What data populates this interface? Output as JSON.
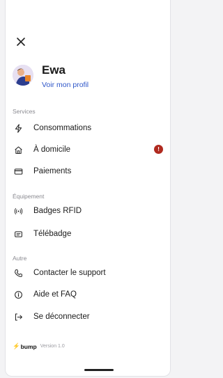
{
  "profile": {
    "name": "Ewa",
    "link": "Voir mon profil"
  },
  "sections": {
    "services": "Services",
    "equipment": "Équipement",
    "other": "Autre"
  },
  "menu": {
    "consommations": {
      "label": "Consommations",
      "icon": "lightning-icon"
    },
    "a_domicile": {
      "label": "À domicile",
      "icon": "home-icon",
      "badge": "!"
    },
    "paiements": {
      "label": "Paiements",
      "icon": "credit-card-icon"
    },
    "badges_rfid": {
      "label": "Badges RFID",
      "icon": "rfid-icon"
    },
    "telebadge": {
      "label": "Télébadge",
      "icon": "telebadge-icon"
    },
    "support": {
      "label": "Contacter le support",
      "icon": "phone-icon"
    },
    "faq": {
      "label": "Aide et FAQ",
      "icon": "info-icon"
    },
    "logout": {
      "label": "Se déconnecter",
      "icon": "logout-icon"
    }
  },
  "footer": {
    "brand": "bump",
    "version": "Version 1.0"
  },
  "colors": {
    "link": "#2d55c8",
    "badge": "#b02a1f",
    "brand_bolt": "#e0392b"
  }
}
